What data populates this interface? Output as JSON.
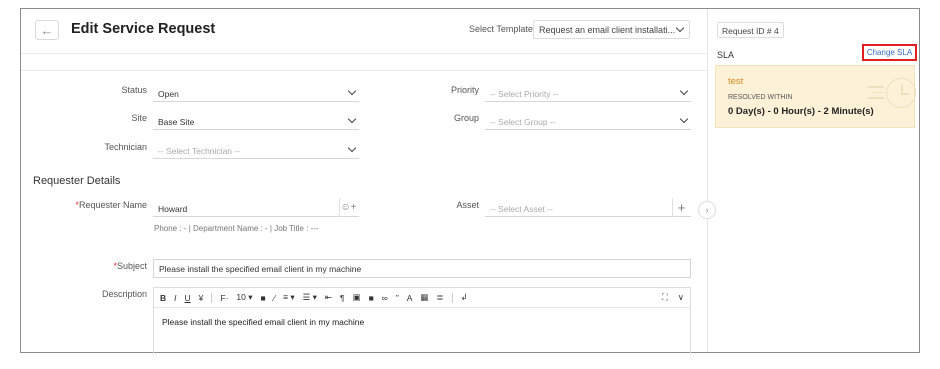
{
  "header": {
    "title": "Edit Service Request",
    "back_icon": "←",
    "template_label": "Select Template",
    "template_value": "Request an email client installati..."
  },
  "fields": {
    "status_label": "Status",
    "status_value": "Open",
    "priority_label": "Priority",
    "priority_value": "-- Select Priority --",
    "site_label": "Site",
    "site_value": "Base Site",
    "group_label": "Group",
    "group_value": "-- Select Group --",
    "technician_label": "Technician",
    "technician_value": "-- Select Technician --"
  },
  "requester": {
    "section_title": "Requester Details",
    "name_label": "Requester Name",
    "name_value": "Howard",
    "asset_label": "Asset",
    "asset_value": "-- Select Asset --",
    "info": "Phone :  -   |   Department Name :  -   |  Job Title : ---",
    "subject_label": "Subject",
    "subject_value": "Please install the specified email client in my machine",
    "description_label": "Description",
    "description_value": "Please install the specified email client in my machine"
  },
  "toolbar": [
    "B",
    "I",
    "U",
    "¥",
    "|",
    "F·",
    "10 ▾",
    "■",
    "∕",
    "≡ ▾",
    "☰ ▾",
    "⇤",
    "¶",
    "▣",
    "■",
    "∞",
    "”",
    "A",
    "▦",
    "≣",
    "|",
    "↲"
  ],
  "toolbar_right": [
    "⛶",
    "∨"
  ],
  "right_panel": {
    "request_id": "Request ID  # 4",
    "sla_label": "SLA",
    "change_sla": "Change SLA",
    "sla_name": "test",
    "resolved_within": "RESOLVED WITHIN",
    "sla_time": "0 Day(s) - 0 Hour(s) - 2 Minute(s)"
  }
}
